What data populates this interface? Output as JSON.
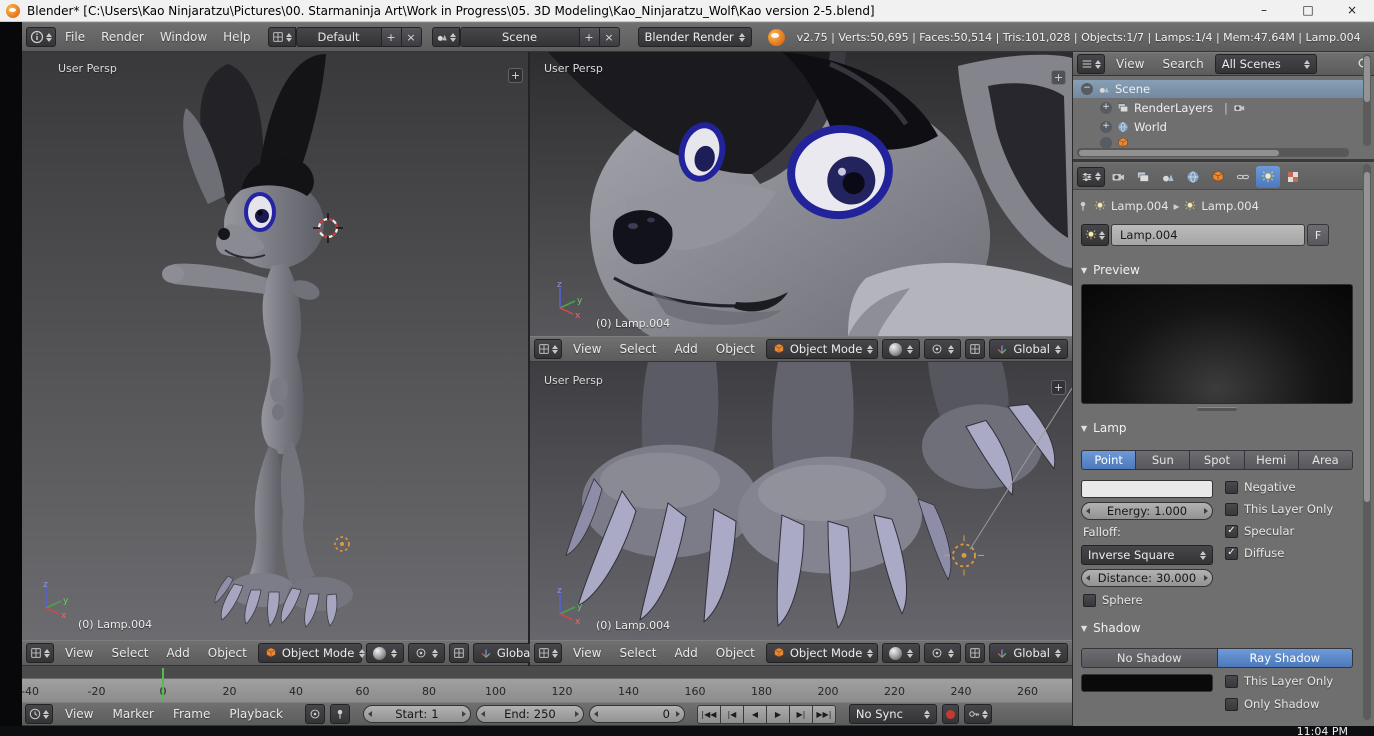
{
  "window": {
    "title": "Blender* [C:\\Users\\Kao Ninjaratzu\\Pictures\\00. Starmaninja Art\\Work in Progress\\05. 3D Modeling\\Kao_Ninjaratzu_Wolf\\Kao version 2-5.blend]",
    "minimize": "–",
    "maximize": "□",
    "close": "×",
    "clock": "11:04 PM"
  },
  "icons": {
    "check": "✓",
    "add": "+",
    "close": "×",
    "panel_arrow": "▼",
    "breadcrumb_arrow": "▸"
  },
  "gizmo": {
    "x": "x",
    "y": "y",
    "z": "z"
  },
  "info_bar": {
    "menus": [
      "File",
      "Render",
      "Window",
      "Help"
    ],
    "layout_name": "Default",
    "scene_name": "Scene",
    "engine": "Blender Render",
    "stats": "v2.75 | Verts:50,695 | Faces:50,514 | Tris:101,028 | Objects:1/7 | Lamps:1/4 | Mem:47.64M | Lamp.004"
  },
  "viewport_header": {
    "menus": [
      "View",
      "Select",
      "Add",
      "Object"
    ],
    "mode": "Object Mode",
    "orientation": "Global"
  },
  "viewports": {
    "left": {
      "label": "User Persp",
      "active_object": "(0) Lamp.004"
    },
    "top_right": {
      "label": "User Persp",
      "active_object": "(0) Lamp.004"
    },
    "bottom_right": {
      "label": "User Persp",
      "active_object": "(0) Lamp.004"
    }
  },
  "outliner": {
    "menus": [
      "View",
      "Search"
    ],
    "filter": "All Scenes",
    "renderlayers_sep": "|",
    "rows": [
      {
        "disc": "−",
        "label": "Scene"
      },
      {
        "disc": "+",
        "label": "RenderLayers"
      },
      {
        "disc": "+",
        "label": "World"
      }
    ]
  },
  "properties": {
    "breadcrumb": {
      "first": "Lamp.004",
      "second": "Lamp.004"
    },
    "name_value": "Lamp.004",
    "fake_user": "F",
    "preview": {
      "title": "Preview"
    },
    "lamp": {
      "title": "Lamp",
      "types": [
        "Point",
        "Sun",
        "Spot",
        "Hemi",
        "Area"
      ],
      "active_type": "Point",
      "negative": "Negative",
      "this_layer_only": "This Layer Only",
      "specular": "Specular",
      "diffuse": "Diffuse",
      "energy_label": "Energy:",
      "energy_value": "1.000",
      "falloff_label": "Falloff:",
      "falloff_value": "Inverse Square",
      "distance_label": "Distance:",
      "distance_value": "30.000",
      "sphere": "Sphere"
    },
    "shadow": {
      "title": "Shadow",
      "buttons": [
        "No Shadow",
        "Ray Shadow"
      ],
      "active": "Ray Shadow",
      "this_layer_only": "This Layer Only",
      "only_shadow": "Only Shadow"
    }
  },
  "timeline": {
    "ticks": [
      "-40",
      "-20",
      "0",
      "20",
      "40",
      "60",
      "80",
      "100",
      "120",
      "140",
      "160",
      "180",
      "200",
      "220",
      "240",
      "260"
    ],
    "current_frame_index": 2,
    "menus": [
      "View",
      "Marker",
      "Frame",
      "Playback"
    ],
    "start_label": "Start:",
    "start_value": "1",
    "end_label": "End:",
    "end_value": "250",
    "frame_value": "0",
    "media": [
      "|◀◀",
      "|◀",
      "◀",
      "▶",
      "▶|",
      "▶▶|"
    ],
    "sync": "No Sync"
  }
}
